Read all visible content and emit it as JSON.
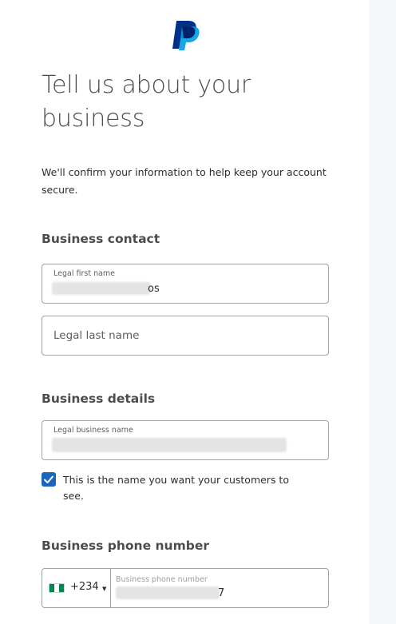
{
  "brand": {
    "logo_icon": "paypal-logo-icon",
    "colors": {
      "dark_blue": "#003087",
      "light_blue": "#009cde"
    }
  },
  "header": {
    "title": "Tell us about your business"
  },
  "intro": {
    "text": "We'll confirm your information to help keep your account secure."
  },
  "business_contact": {
    "heading": "Business contact",
    "first_name": {
      "label": "Legal first name",
      "value": "os"
    },
    "last_name": {
      "placeholder": "Legal last name"
    }
  },
  "business_details": {
    "heading": "Business details",
    "business_name": {
      "label": "Legal business name",
      "value": ""
    },
    "same_name_checkbox": {
      "label": "This is the name you want your customers to see.",
      "checked": true
    }
  },
  "phone": {
    "heading": "Business phone number",
    "country": {
      "flag_icon": "nigeria-flag-icon",
      "dial_code": "+234"
    },
    "number": {
      "label": "Business phone number",
      "value": "7"
    }
  },
  "colors": {
    "accent": "#1a66bd",
    "border": "#9da3a6",
    "side_panel": "#f5f7fa"
  }
}
